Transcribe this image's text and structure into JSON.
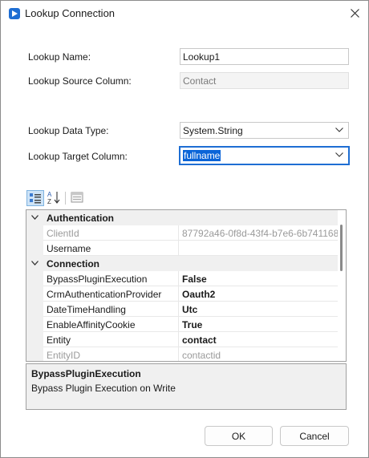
{
  "window": {
    "title": "Lookup Connection"
  },
  "form": {
    "lookup_name_label": "Lookup Name:",
    "lookup_name_value": "Lookup1",
    "source_column_label": "Lookup Source Column:",
    "source_column_value": "Contact",
    "data_type_label": "Lookup Data Type:",
    "data_type_value": "System.String",
    "target_column_label": "Lookup Target Column:",
    "target_column_value": "fullname"
  },
  "toolbar": {
    "categorized_icon": "categorized-icon",
    "alphabetical_icon": "alphabetical-sort-icon",
    "property_pages_icon": "property-pages-icon"
  },
  "property_grid": {
    "categories": [
      {
        "name": "Authentication",
        "rows": [
          {
            "name": "ClientId",
            "value": "87792a46-0f8d-43f4-b7e6-6b741168",
            "readonly": true
          },
          {
            "name": "Username",
            "value": "",
            "readonly": false
          }
        ]
      },
      {
        "name": "Connection",
        "rows": [
          {
            "name": "BypassPluginExecution",
            "value": "False",
            "bold": true
          },
          {
            "name": "CrmAuthenticationProvider",
            "value": "Oauth2",
            "bold": true
          },
          {
            "name": "DateTimeHandling",
            "value": "Utc",
            "bold": true
          },
          {
            "name": "EnableAffinityCookie",
            "value": "True",
            "bold": true
          },
          {
            "name": "Entity",
            "value": "contact",
            "bold": true
          },
          {
            "name": "EntityID",
            "value": "contactid",
            "readonly": true
          }
        ]
      }
    ]
  },
  "description": {
    "title": "BypassPluginExecution",
    "text": "Bypass Plugin Execution on Write"
  },
  "buttons": {
    "ok": "OK",
    "cancel": "Cancel"
  },
  "colors": {
    "accent": "#1e6ed3",
    "selection": "#0a64d8"
  }
}
